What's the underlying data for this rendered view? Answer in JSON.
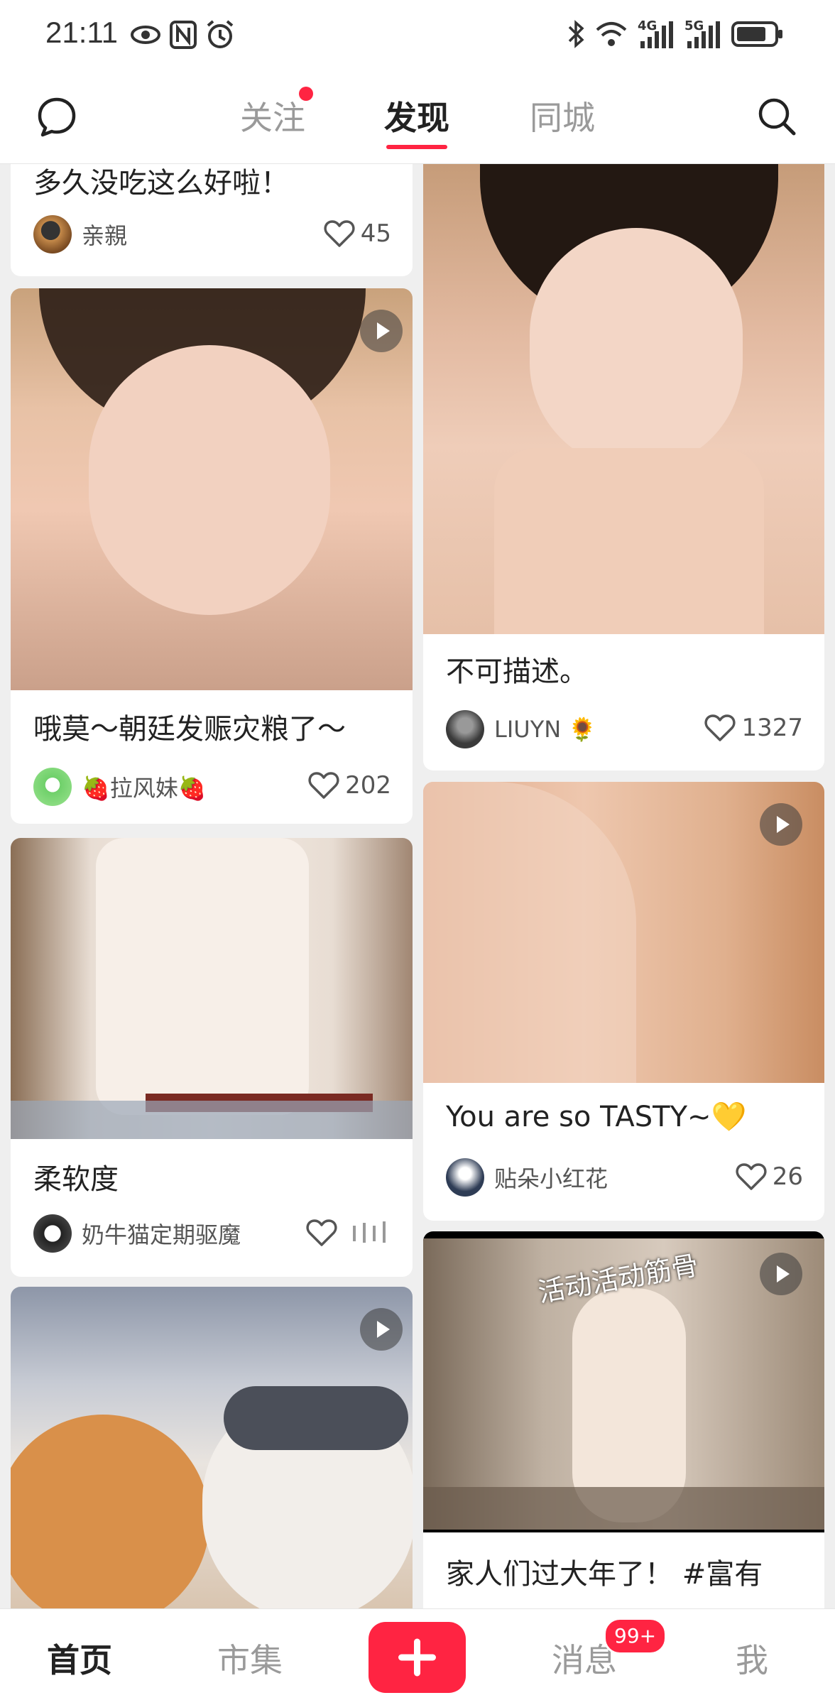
{
  "status_bar": {
    "time": "21:11",
    "network_4g": "4G",
    "network_5g": "5G"
  },
  "top_nav": {
    "tabs": [
      {
        "label": "关注"
      },
      {
        "label": "发现"
      },
      {
        "label": "同城"
      }
    ]
  },
  "feed": {
    "left": [
      {
        "title": "多久没吃这么好啦！",
        "author": "亲親",
        "likes": "45"
      },
      {
        "title": "哦莫～朝廷发赈灾粮了～",
        "author": "🍓拉风妹🍓",
        "likes": "202"
      },
      {
        "title": "柔软度",
        "author": "奶牛猫定期驱魔",
        "likes": ""
      },
      {
        "title": "",
        "author": "",
        "likes": ""
      }
    ],
    "right": [
      {
        "title": "不可描述。",
        "author": "LIUYN 🌻",
        "likes": "1327"
      },
      {
        "title": "You are so TASTY~💛",
        "author": "贴朵小红花",
        "likes": "26"
      },
      {
        "title": "家人们过大年了！ #富有",
        "overlay_text": "活动活动筋骨",
        "author": "",
        "likes": ""
      }
    ]
  },
  "bottom_bar": {
    "items": [
      {
        "label": "首页"
      },
      {
        "label": "市集"
      },
      {
        "label": "消息"
      },
      {
        "label": "我"
      }
    ],
    "badge": "99+"
  },
  "colors": {
    "accent": "#ff2442",
    "text": "#222222",
    "muted": "#9a9a9a"
  },
  "icons": [
    "chat-bubble-icon",
    "search-icon",
    "heart-icon",
    "play-icon",
    "plus-icon"
  ]
}
